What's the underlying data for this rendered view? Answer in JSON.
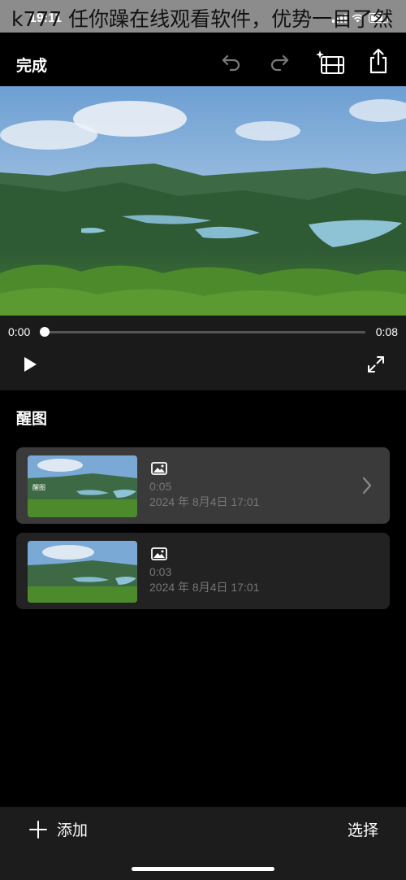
{
  "status": {
    "time": "19:11"
  },
  "overlay": {
    "title": "k777 任你躁在线观看软件，优势一目了然"
  },
  "nav": {
    "done_label": "完成"
  },
  "player": {
    "current_time": "0:00",
    "total_time": "0:08",
    "progress": 0
  },
  "section": {
    "title": "醒图"
  },
  "clips": [
    {
      "thumb_label": "醒图",
      "duration": "0:05",
      "date": "2024 年 8月4日 17:01",
      "selected": true
    },
    {
      "thumb_label": "",
      "duration": "0:03",
      "date": "2024 年 8月4日 17:01",
      "selected": false
    }
  ],
  "bottom": {
    "add_label": "添加",
    "select_label": "选择"
  },
  "colors": {
    "background": "#000000",
    "card": "#222222",
    "card_selected": "#3a3a3a",
    "secondary_text": "#777777"
  }
}
